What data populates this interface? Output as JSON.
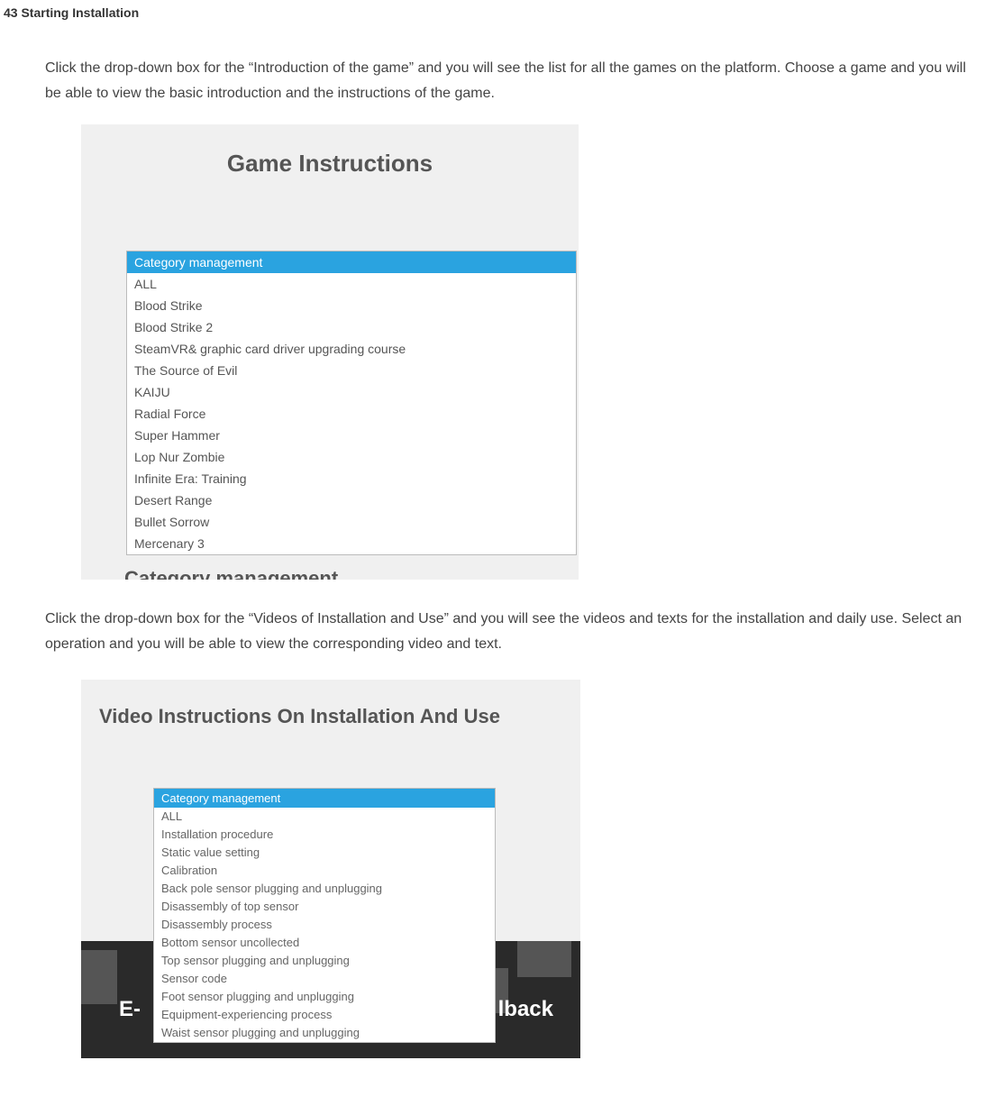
{
  "header": "43  Starting Installation",
  "para1": "Click the drop-down box for the “Introduction of the game” and you will see the list for all the games on the platform. Choose a game and you will be able to view the basic introduction and the instructions of the game.",
  "panel1": {
    "title": "Game Instructions",
    "dropdown_header": "Category management",
    "items": [
      "ALL",
      "Blood Strike",
      "Blood Strike 2",
      "SteamVR& graphic card driver upgrading course",
      "The Source of Evil",
      "KAIJU",
      "Radial Force",
      "Super Hammer",
      "Lop Nur Zombie",
      "Infinite Era: Training",
      "Desert Range",
      "Bullet Sorrow",
      "Mercenary 3"
    ],
    "cut_text": "Category management"
  },
  "para2": "Click the drop-down box for the “Videos of Installation and Use” and you will see the videos and texts for the installation and daily use. Select an operation and you will be able to view the corresponding video and text.",
  "panel2": {
    "title": "Video Instructions On Installation And Use",
    "dropdown_header": "Category management",
    "items": [
      "ALL",
      "Installation procedure",
      "Static value setting",
      "Calibration",
      "Back pole sensor plugging and unplugging",
      "Disassembly of top sensor",
      "Disassembly process",
      "Bottom sensor uncollected",
      "Top sensor plugging and unplugging",
      "Sensor code",
      "Foot sensor plugging and unplugging",
      "Equipment-experiencing process",
      "Waist sensor plugging and unplugging"
    ],
    "bg_left_text": "E-",
    "bg_right_text": "lback"
  }
}
